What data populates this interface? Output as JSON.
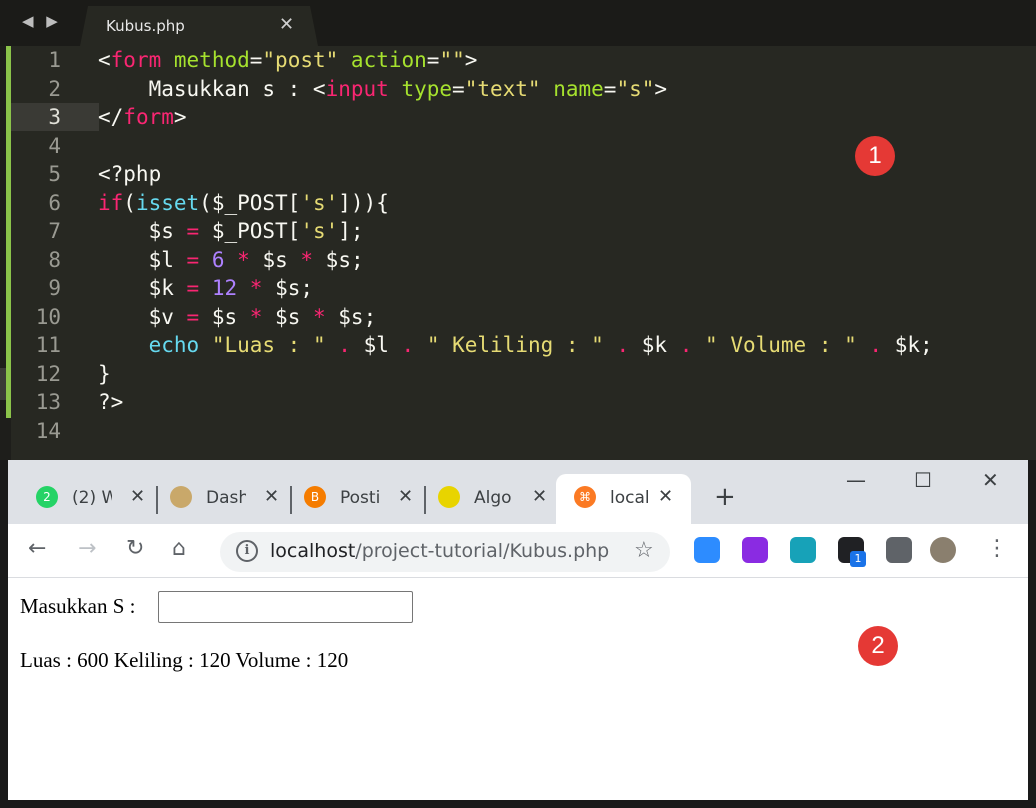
{
  "editor": {
    "tab_title": "Kubus.php",
    "nav_arrows": "◀ ▶",
    "close_glyph": "✕",
    "lines": [
      {
        "num": "1",
        "tokens": [
          [
            "w",
            "<"
          ],
          [
            "k",
            "form"
          ],
          [
            "w",
            " "
          ],
          [
            "a",
            "method"
          ],
          [
            "w",
            "="
          ],
          [
            "s",
            "\"post\""
          ],
          [
            "w",
            " "
          ],
          [
            "a",
            "action"
          ],
          [
            "w",
            "="
          ],
          [
            "s",
            "\"\""
          ],
          [
            "w",
            ">"
          ]
        ]
      },
      {
        "num": "2",
        "tokens": [
          [
            "w",
            "    Masukkan s : <"
          ],
          [
            "k",
            "input"
          ],
          [
            "w",
            " "
          ],
          [
            "a",
            "type"
          ],
          [
            "w",
            "="
          ],
          [
            "s",
            "\"text\""
          ],
          [
            "w",
            " "
          ],
          [
            "a",
            "name"
          ],
          [
            "w",
            "="
          ],
          [
            "s",
            "\"s\""
          ],
          [
            "w",
            ">"
          ]
        ]
      },
      {
        "num": "3",
        "tokens": [
          [
            "w",
            "</"
          ],
          [
            "k",
            "form"
          ],
          [
            "w",
            ">"
          ]
        ]
      },
      {
        "num": "4",
        "tokens": []
      },
      {
        "num": "5",
        "tokens": [
          [
            "w",
            "<?php"
          ]
        ]
      },
      {
        "num": "6",
        "tokens": [
          [
            "k",
            "if"
          ],
          [
            "w",
            "("
          ],
          [
            "f",
            "isset"
          ],
          [
            "w",
            "($_POST["
          ],
          [
            "s",
            "'s'"
          ],
          [
            "w",
            "])){"
          ]
        ]
      },
      {
        "num": "7",
        "tokens": [
          [
            "w",
            "    $s "
          ],
          [
            "k",
            "="
          ],
          [
            "w",
            " $_POST["
          ],
          [
            "s",
            "'s'"
          ],
          [
            "w",
            "];"
          ]
        ]
      },
      {
        "num": "8",
        "tokens": [
          [
            "w",
            "    $l "
          ],
          [
            "k",
            "="
          ],
          [
            "w",
            " "
          ],
          [
            "n",
            "6"
          ],
          [
            "w",
            " "
          ],
          [
            "k",
            "*"
          ],
          [
            "w",
            " $s "
          ],
          [
            "k",
            "*"
          ],
          [
            "w",
            " $s;"
          ]
        ]
      },
      {
        "num": "9",
        "tokens": [
          [
            "w",
            "    $k "
          ],
          [
            "k",
            "="
          ],
          [
            "w",
            " "
          ],
          [
            "n",
            "12"
          ],
          [
            "w",
            " "
          ],
          [
            "k",
            "*"
          ],
          [
            "w",
            " $s;"
          ]
        ]
      },
      {
        "num": "10",
        "tokens": [
          [
            "w",
            "    $v "
          ],
          [
            "k",
            "="
          ],
          [
            "w",
            " $s "
          ],
          [
            "k",
            "*"
          ],
          [
            "w",
            " $s "
          ],
          [
            "k",
            "*"
          ],
          [
            "w",
            " $s;"
          ]
        ]
      },
      {
        "num": "11",
        "tokens": [
          [
            "w",
            "    "
          ],
          [
            "f",
            "echo"
          ],
          [
            "w",
            " "
          ],
          [
            "s",
            "\"Luas : \""
          ],
          [
            "w",
            " "
          ],
          [
            "k",
            "."
          ],
          [
            "w",
            " $l "
          ],
          [
            "k",
            "."
          ],
          [
            "w",
            " "
          ],
          [
            "s",
            "\" Keliling : \""
          ],
          [
            "w",
            " "
          ],
          [
            "k",
            "."
          ],
          [
            "w",
            " $k "
          ],
          [
            "k",
            "."
          ],
          [
            "w",
            " "
          ],
          [
            "s",
            "\" Volume : \""
          ],
          [
            "w",
            " "
          ],
          [
            "k",
            "."
          ],
          [
            "w",
            " $k;"
          ]
        ]
      },
      {
        "num": "12",
        "tokens": [
          [
            "w",
            "}"
          ]
        ]
      },
      {
        "num": "13",
        "tokens": [
          [
            "w",
            "?>"
          ]
        ]
      },
      {
        "num": "14",
        "tokens": []
      }
    ]
  },
  "browser": {
    "tabs": [
      {
        "title": "(2) W",
        "icon": "whatsapp-icon",
        "icon_color": "#25d366",
        "icon_text": "2"
      },
      {
        "title": "Dash",
        "icon": "emblem-icon",
        "icon_color": "#c9a86a",
        "icon_text": ""
      },
      {
        "title": "Posti",
        "icon": "blogger-icon",
        "icon_color": "#f57c00",
        "icon_text": "B"
      },
      {
        "title": "Algo",
        "icon": "site-logo-icon",
        "icon_color": "#e8d400",
        "icon_text": ""
      },
      {
        "title": "local",
        "icon": "xampp-icon",
        "icon_color": "#fb7a24",
        "icon_text": "⌘"
      }
    ],
    "new_tab": "+",
    "window_controls": {
      "minimize": "—",
      "maximize": "☐",
      "close": "✕"
    },
    "nav": {
      "back": "←",
      "forward": "→",
      "reload": "↻",
      "home": "⌂"
    },
    "url_host": "localhost",
    "url_path": "/project-tutorial/Kubus.php",
    "info_glyph": "i",
    "star": "☆",
    "extensions": [
      {
        "name": "zoom-icon",
        "color": "#2d8cff"
      },
      {
        "name": "pixel-icon",
        "color": "#8a2be2"
      },
      {
        "name": "notion-ext-icon",
        "color": "#17a2b8"
      },
      {
        "name": "package-icon",
        "color": "#202124"
      },
      {
        "name": "puzzle-icon",
        "color": "#5f6368"
      }
    ],
    "ext_badge": "1",
    "menu": "⋮"
  },
  "page": {
    "label": "Masukkan S :",
    "result": "Luas : 600 Keliling : 120 Volume : 120"
  },
  "badges": {
    "first": "1",
    "second": "2"
  }
}
